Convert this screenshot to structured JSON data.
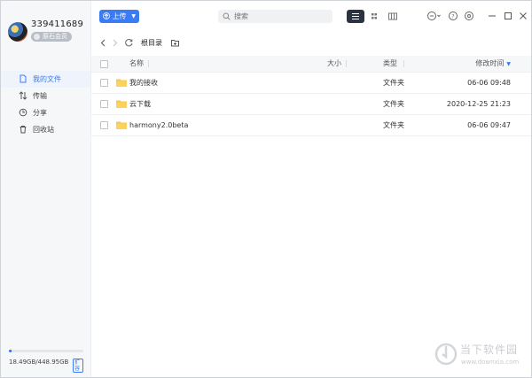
{
  "user": {
    "name": "339411689",
    "badge": "原石会员"
  },
  "sidebar": {
    "items": [
      {
        "label": "我的文件",
        "icon": "file-icon",
        "active": true
      },
      {
        "label": "传输",
        "icon": "transfer-icon",
        "active": false
      },
      {
        "label": "分享",
        "icon": "share-icon",
        "active": false
      },
      {
        "label": "回收站",
        "icon": "trash-icon",
        "active": false
      }
    ],
    "storage": {
      "text": "18.49GB/448.95GB",
      "expand_label": "扩容",
      "used_fraction": 0.041
    }
  },
  "toolbar": {
    "upload_label": "上传",
    "search_placeholder": "搜索"
  },
  "path": {
    "crumb": "根目录"
  },
  "table": {
    "headers": {
      "name": "名称",
      "size": "大小",
      "type": "类型",
      "time": "修改时间"
    },
    "rows": [
      {
        "name": "我的接收",
        "size": "",
        "type": "文件夹",
        "time": "06-06 09:48"
      },
      {
        "name": "云下载",
        "size": "",
        "type": "文件夹",
        "time": "2020-12-25 21:23"
      },
      {
        "name": "harmony2.0beta",
        "size": "",
        "type": "文件夹",
        "time": "06-06 09:47"
      }
    ]
  },
  "watermark": {
    "text": "当下软件园",
    "url": "www.downxia.com"
  },
  "colors": {
    "accent": "#3a7bf6",
    "folder": "#f7c549",
    "sidebar_bg": "#f6f7f9"
  }
}
